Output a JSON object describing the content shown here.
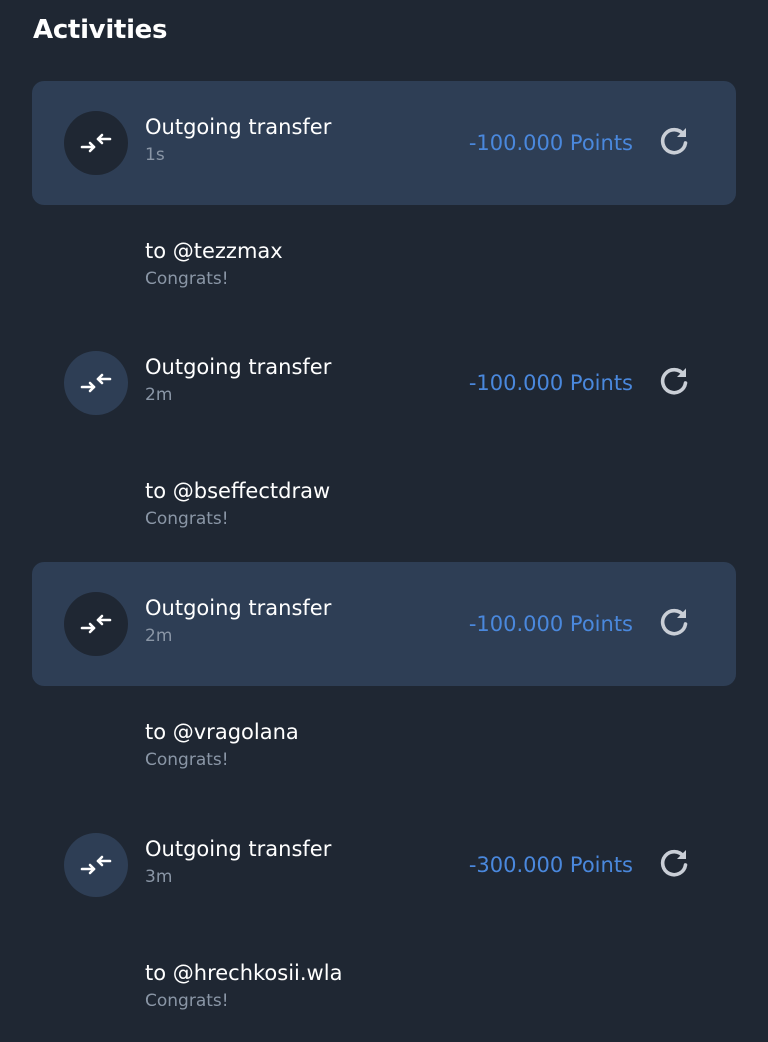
{
  "header": {
    "title": "Activities"
  },
  "activities": [
    {
      "title": "Outgoing transfer",
      "time": "1s",
      "amount": "-100.000 Points",
      "to": "to @tezzmax",
      "memo": "Congrats!",
      "highlighted": true,
      "icon": "transfer-arrows-icon",
      "action_icon": "refresh-icon"
    },
    {
      "title": "Outgoing transfer",
      "time": "2m",
      "amount": "-100.000 Points",
      "to": "to @bseffectdraw",
      "memo": "Congrats!",
      "highlighted": false,
      "icon": "transfer-arrows-icon",
      "action_icon": "refresh-icon"
    },
    {
      "title": "Outgoing transfer",
      "time": "2m",
      "amount": "-100.000 Points",
      "to": "to @vragolana",
      "memo": "Congrats!",
      "highlighted": true,
      "icon": "transfer-arrows-icon",
      "action_icon": "refresh-icon"
    },
    {
      "title": "Outgoing transfer",
      "time": "3m",
      "amount": "-300.000 Points",
      "to": "to @hrechkosii.wla",
      "memo": "Congrats!",
      "highlighted": false,
      "icon": "transfer-arrows-icon",
      "action_icon": "refresh-icon"
    }
  ],
  "colors": {
    "background": "#1f2733",
    "highlight": "#2e3e55",
    "amount": "#4a88dd",
    "muted_text": "#8a96a6"
  }
}
